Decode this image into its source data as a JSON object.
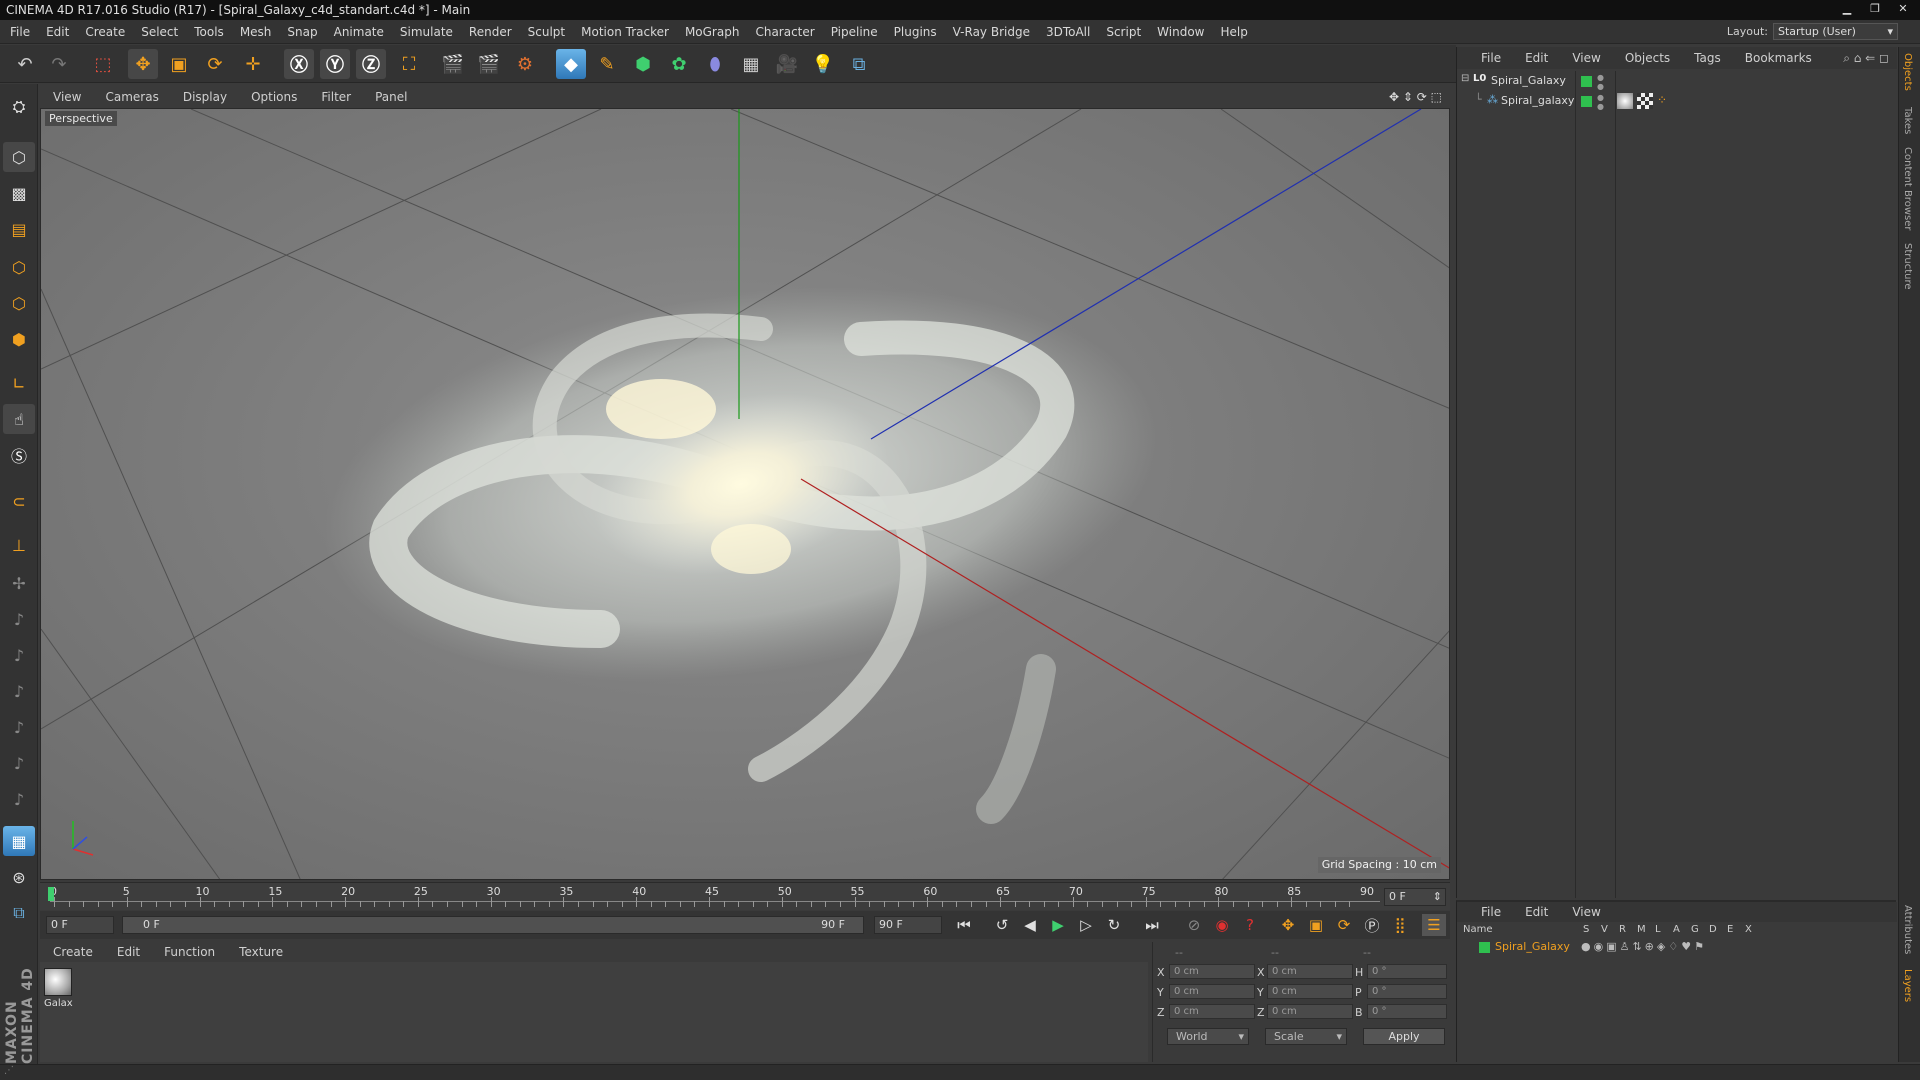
{
  "window": {
    "title": "CINEMA 4D R17.016 Studio (R17) - [Spiral_Galaxy_c4d_standart.c4d *] - Main"
  },
  "menubar": {
    "items": [
      "File",
      "Edit",
      "Create",
      "Select",
      "Tools",
      "Mesh",
      "Snap",
      "Animate",
      "Simulate",
      "Render",
      "Sculpt",
      "Motion Tracker",
      "MoGraph",
      "Character",
      "Pipeline",
      "Plugins",
      "V-Ray Bridge",
      "3DToAll",
      "Script",
      "Window",
      "Help"
    ],
    "layout_label": "Layout:",
    "layout_value": "Startup (User)"
  },
  "viewport": {
    "menu": [
      "View",
      "Cameras",
      "Display",
      "Options",
      "Filter",
      "Panel"
    ],
    "label": "Perspective",
    "grid_spacing": "Grid Spacing : 10 cm"
  },
  "timeline": {
    "ticks": [
      "0",
      "5",
      "10",
      "15",
      "20",
      "25",
      "30",
      "35",
      "40",
      "45",
      "50",
      "55",
      "60",
      "65",
      "70",
      "75",
      "80",
      "85",
      "90"
    ],
    "current_frame": "0 F"
  },
  "transport": {
    "start_field": "0 F",
    "range_start": "0 F",
    "range_end": "90 F",
    "end_field": "90 F"
  },
  "materials": {
    "menu": [
      "Create",
      "Edit",
      "Function",
      "Texture"
    ],
    "items": [
      {
        "label": "Galax"
      }
    ]
  },
  "coords": {
    "header": [
      "--",
      "--",
      "--"
    ],
    "rows": [
      {
        "a": "X",
        "av": "0 cm",
        "b": "X",
        "bv": "0 cm",
        "c": "H",
        "cv": "0 °"
      },
      {
        "a": "Y",
        "av": "0 cm",
        "b": "Y",
        "bv": "0 cm",
        "c": "P",
        "cv": "0 °"
      },
      {
        "a": "Z",
        "av": "0 cm",
        "b": "Z",
        "bv": "0 cm",
        "c": "B",
        "cv": "0 °"
      }
    ],
    "mode": "World",
    "size_mode": "Scale",
    "apply": "Apply"
  },
  "object_manager": {
    "menu": [
      "File",
      "Edit",
      "View",
      "Objects",
      "Tags",
      "Bookmarks"
    ],
    "objects": [
      {
        "name": "Spiral_Galaxy",
        "level": 0
      },
      {
        "name": "Spiral_galaxy",
        "level": 1
      }
    ]
  },
  "layer_manager": {
    "menu": [
      "File",
      "Edit",
      "View"
    ],
    "columns": [
      "Name",
      "S",
      "V",
      "R",
      "M",
      "L",
      "A",
      "G",
      "D",
      "E",
      "X"
    ],
    "layers": [
      {
        "name": "Spiral_Galaxy"
      }
    ]
  },
  "right_tabs": [
    "Objects",
    "Takes",
    "Content Browser",
    "Structure",
    "Attributes",
    "Layers"
  ],
  "branding": "MAXON CINEMA 4D",
  "colors": {
    "accent": "#f0a020",
    "layer_name": "#f0a020",
    "green_dot": "#2fbf4f",
    "x_axis": "#c02020",
    "y_axis": "#20a020",
    "z_axis": "#2030c0"
  }
}
